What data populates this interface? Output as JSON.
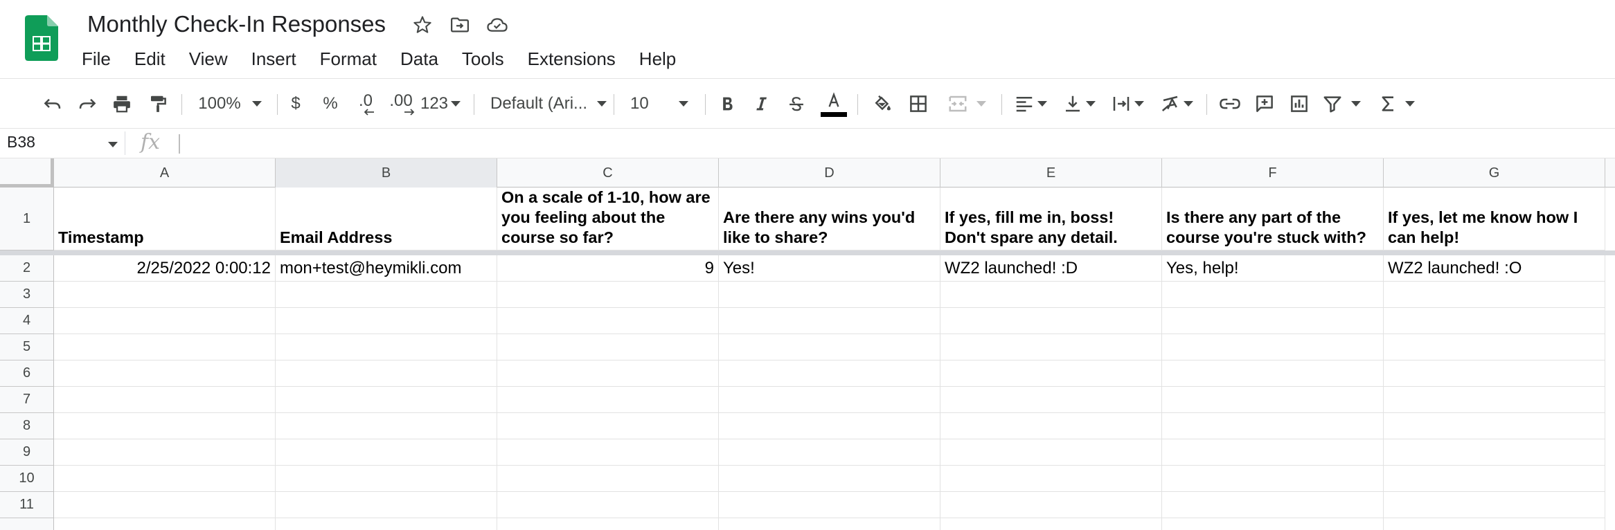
{
  "app": {
    "doc_title": "Monthly Check-In Responses",
    "brand_color": "#0f9d58",
    "title_icons": [
      "star-icon",
      "move-to-folder-icon",
      "cloud-saved-icon"
    ]
  },
  "menu": {
    "items": [
      "File",
      "Edit",
      "View",
      "Insert",
      "Format",
      "Data",
      "Tools",
      "Extensions",
      "Help"
    ]
  },
  "toolbar": {
    "zoom": "100%",
    "currency": "$",
    "percent": "%",
    "decrease_decimals": ".0",
    "increase_decimals": ".00",
    "more_formats": "123",
    "font_family": "Default (Ari...",
    "font_size": "10",
    "text_color": "#000000"
  },
  "formula_bar": {
    "name_box": "B38",
    "fx": "fx",
    "value": ""
  },
  "sheet": {
    "columns": [
      "A",
      "B",
      "C",
      "D",
      "E",
      "F",
      "G"
    ],
    "selected_column": "B",
    "rows": [
      "1",
      "2",
      "3",
      "4",
      "5",
      "6",
      "7",
      "8",
      "9",
      "10",
      "11"
    ],
    "header_row": [
      "Timestamp",
      "Email Address",
      "On a scale of 1-10, how are you feeling about the course so far?",
      "Are there any wins you'd like to share?",
      "If yes, fill me in, boss! Don't spare any detail.",
      "Is there any part of the course you're stuck with?",
      "If yes, let me know how I can help!"
    ],
    "data_rows": [
      [
        "2/25/2022 0:00:12",
        "mon+test@heymikli.com",
        "9",
        "Yes!",
        "WZ2 launched! :D",
        "Yes, help!",
        "WZ2 launched! :O"
      ]
    ]
  }
}
